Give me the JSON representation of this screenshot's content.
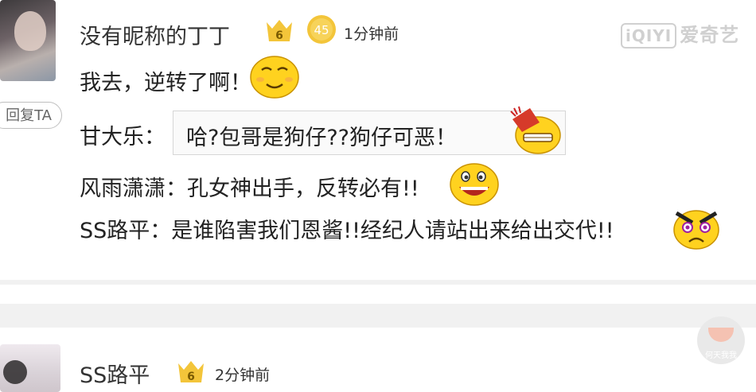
{
  "comment1": {
    "username": "没有昵称的丁丁",
    "vip_level": "6",
    "fan_level": "45",
    "time": "1分钟前",
    "content": "我去，逆转了啊！",
    "reply_button": "回复TA",
    "replies": [
      {
        "user": "甘大乐：",
        "text": "哈?包哥是狗仔??狗仔可恶！"
      },
      {
        "user": "风雨潇潇：",
        "text": "孔女神出手，反转必有!!"
      },
      {
        "user": "SS路平：",
        "text": "是谁陷害我们恩酱!!经纪人请站出来给出交代!!"
      }
    ]
  },
  "comment2": {
    "username": "SS路平",
    "vip_level": "6",
    "time": "2分钟前"
  },
  "watermark": {
    "box": "iQIYI",
    "text": "爱奇艺"
  },
  "floating_label": "何天我我",
  "colors": {
    "badge_gold": "#f3c53a",
    "divider": "#f1f1f1",
    "emoji_yellow": "#ffd21f"
  }
}
